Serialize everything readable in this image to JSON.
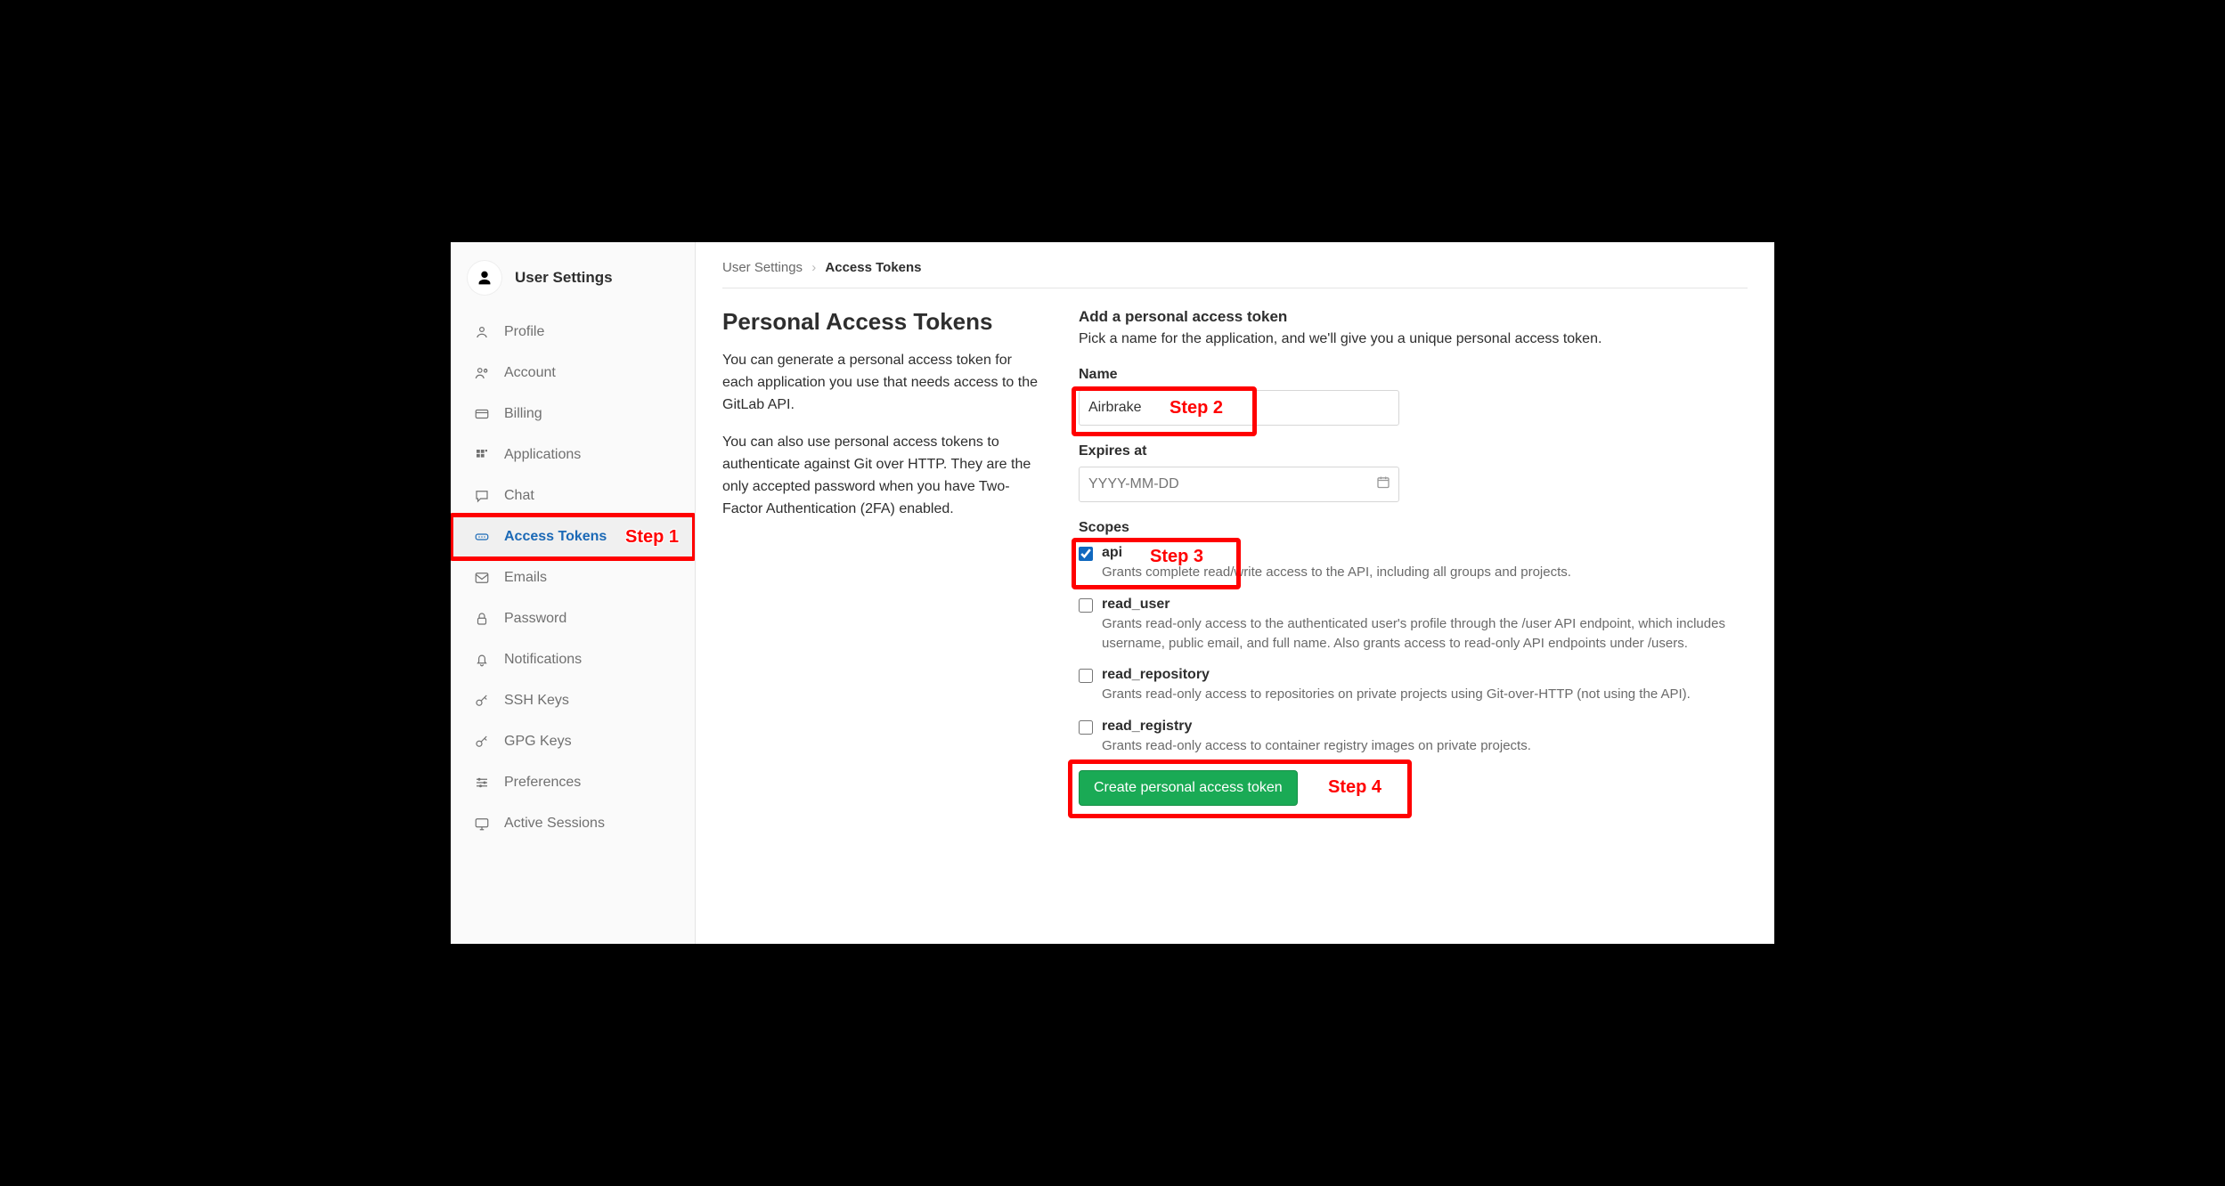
{
  "sidebar": {
    "title": "User Settings",
    "items": [
      {
        "label": "Profile",
        "icon": "profile"
      },
      {
        "label": "Account",
        "icon": "account"
      },
      {
        "label": "Billing",
        "icon": "billing"
      },
      {
        "label": "Applications",
        "icon": "apps"
      },
      {
        "label": "Chat",
        "icon": "chat"
      },
      {
        "label": "Access Tokens",
        "icon": "token",
        "active": true
      },
      {
        "label": "Emails",
        "icon": "emails"
      },
      {
        "label": "Password",
        "icon": "password"
      },
      {
        "label": "Notifications",
        "icon": "bell"
      },
      {
        "label": "SSH Keys",
        "icon": "key"
      },
      {
        "label": "GPG Keys",
        "icon": "key"
      },
      {
        "label": "Preferences",
        "icon": "prefs"
      },
      {
        "label": "Active Sessions",
        "icon": "sessions"
      }
    ]
  },
  "breadcrumbs": {
    "root": "User Settings",
    "current": "Access Tokens"
  },
  "page": {
    "title": "Personal Access Tokens",
    "para1": "You can generate a personal access token for each application you use that needs access to the GitLab API.",
    "para2": "You can also use personal access tokens to authenticate against Git over HTTP. They are the only accepted password when you have Two-Factor Authentication (2FA) enabled."
  },
  "form": {
    "heading": "Add a personal access token",
    "subheading": "Pick a name for the application, and we'll give you a unique personal access token.",
    "name_label": "Name",
    "name_value": "Airbrake",
    "expires_label": "Expires at",
    "expires_placeholder": "YYYY-MM-DD",
    "scopes_label": "Scopes",
    "scopes": [
      {
        "key": "api",
        "checked": true,
        "desc": "Grants complete read/write access to the API, including all groups and projects."
      },
      {
        "key": "read_user",
        "checked": false,
        "desc": "Grants read-only access to the authenticated user's profile through the /user API endpoint, which includes username, public email, and full name. Also grants access to read-only API endpoints under /users."
      },
      {
        "key": "read_repository",
        "checked": false,
        "desc": "Grants read-only access to repositories on private projects using Git-over-HTTP (not using the API)."
      },
      {
        "key": "read_registry",
        "checked": false,
        "desc": "Grants read-only access to container registry images on private projects."
      }
    ],
    "submit_label": "Create personal access token"
  },
  "annotations": {
    "step1": "Step 1",
    "step2": "Step 2",
    "step3": "Step 3",
    "step4": "Step 4"
  }
}
